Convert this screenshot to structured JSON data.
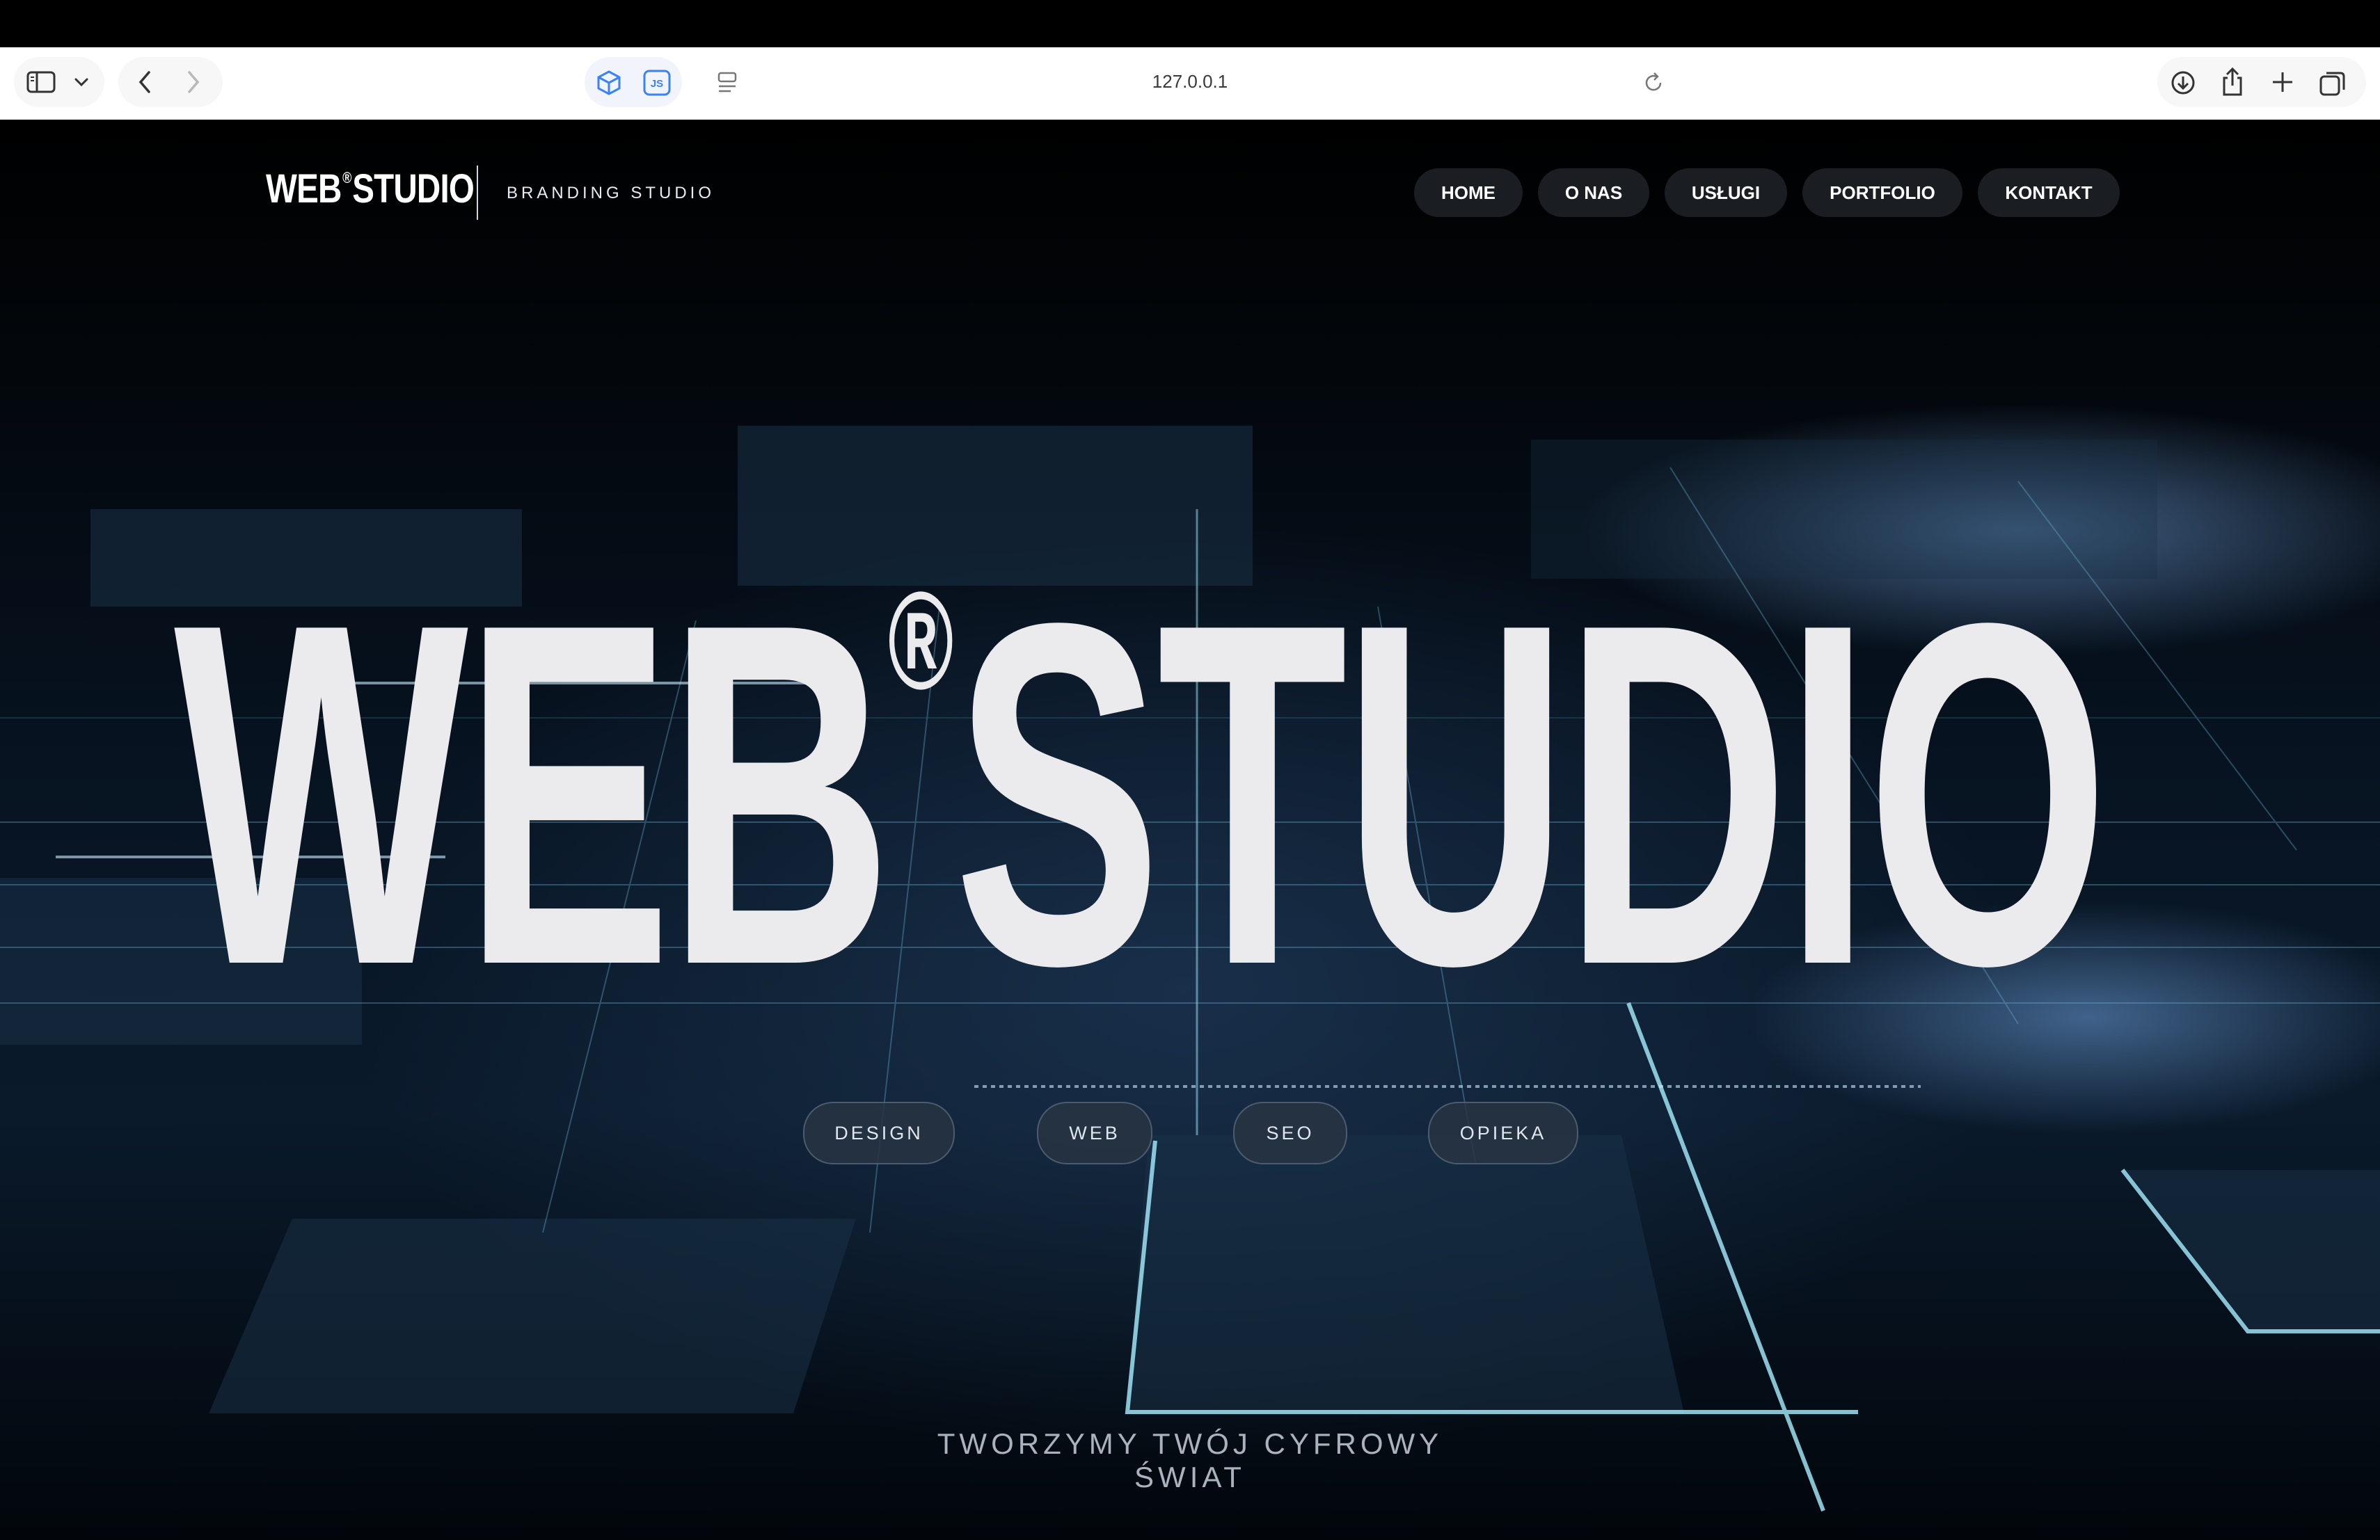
{
  "browser": {
    "url": "127.0.0.1",
    "js_badge": "JS"
  },
  "header": {
    "logo_left": "WEB",
    "logo_mark": "®",
    "logo_right": "STUDIO",
    "tagline": "BRANDING STUDIO"
  },
  "nav": {
    "items": [
      "HOME",
      "O NAS",
      "USŁUGI",
      "PORTFOLIO",
      "KONTAKT"
    ]
  },
  "hero": {
    "title_left": "WEB",
    "title_mark": "®",
    "title_right": "STUDIO",
    "chips": [
      "DESIGN",
      "WEB",
      "SEO",
      "OPIEKA"
    ],
    "tagline": "TWORZYMY TWÓJ CYFROWY ŚWIAT"
  },
  "colors": {
    "page_bg": "#000000",
    "nav_pill": "#1a1d22",
    "title": "#ebebee",
    "grid_line": "#8fd8ee"
  }
}
